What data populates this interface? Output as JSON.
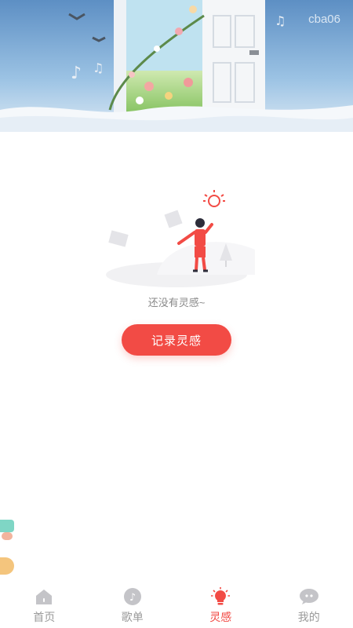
{
  "banner": {
    "watermark": "cba06"
  },
  "empty_state": {
    "message": "还没有灵感~"
  },
  "actions": {
    "record_label": "记录灵感"
  },
  "tabbar": {
    "items": [
      {
        "label": "首页",
        "icon": "home-icon"
      },
      {
        "label": "歌单",
        "icon": "playlist-icon"
      },
      {
        "label": "灵感",
        "icon": "lightbulb-icon",
        "active": true
      },
      {
        "label": "我的",
        "icon": "profile-chat-icon"
      }
    ]
  },
  "colors": {
    "accent": "#f24b45",
    "inactive": "#9a9a9a"
  }
}
